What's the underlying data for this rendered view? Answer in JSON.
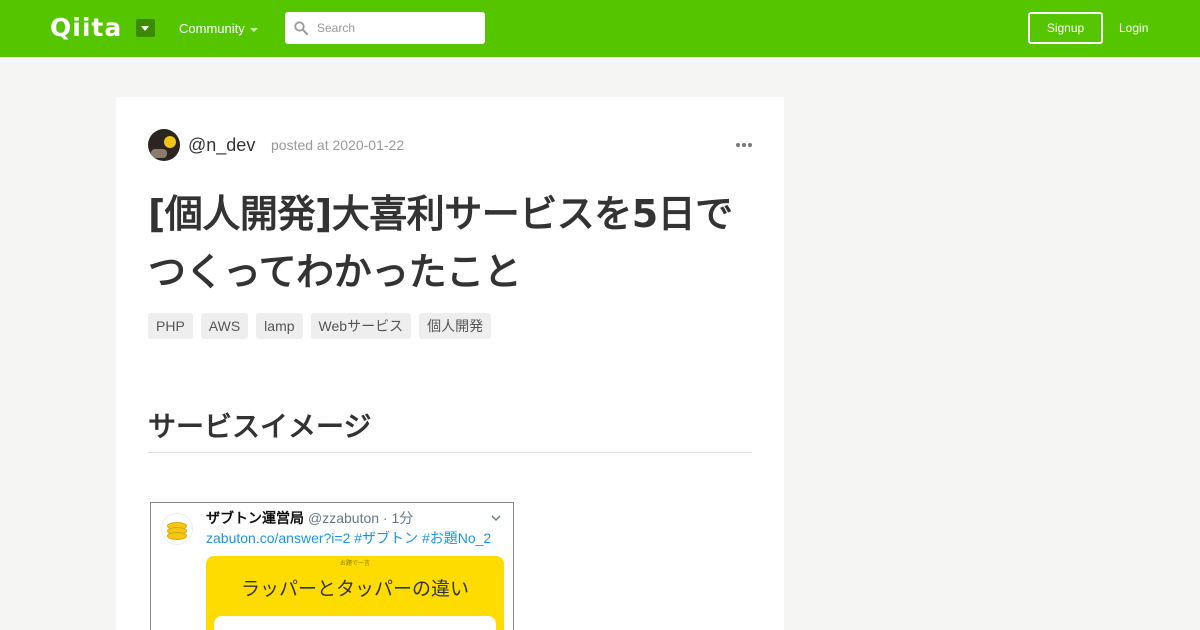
{
  "header": {
    "logo": "Qiita",
    "community_label": "Community",
    "search_placeholder": "Search",
    "signup_label": "Signup",
    "login_label": "Login",
    "bg_color": "#55c500"
  },
  "article": {
    "author": "@n_dev",
    "posted": "posted at 2020-01-22",
    "title": "[個人開発]大喜利サービスを5日でつくってわかったこと",
    "tags": [
      "PHP",
      "AWS",
      "lamp",
      "Webサービス",
      "個人開発"
    ],
    "section_heading": "サービスイメージ"
  },
  "embedded_tweet": {
    "account_name": "ザブトン運営局",
    "handle": "@zzabuton · 1分",
    "link_text": "zabuton.co/answer?i=2 #ザブトン #お題No_2",
    "card_small": "お題で一言",
    "card_title": "ラッパーとタッパーの違い"
  },
  "icons": [
    "logo-menu-icon",
    "caret-down-icon",
    "search-icon",
    "more-icon",
    "chevron-down-icon"
  ]
}
